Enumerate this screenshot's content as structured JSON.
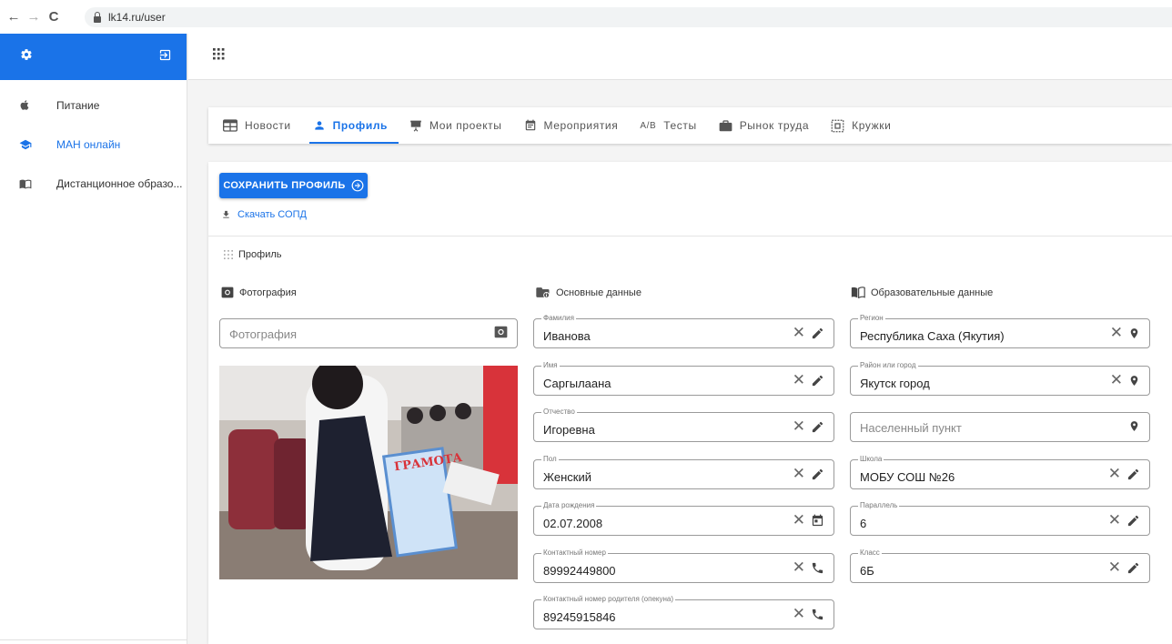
{
  "browser": {
    "url": "lk14.ru/user",
    "back_icon": "←",
    "forward_icon": "→",
    "reload_icon": "C"
  },
  "sidebar": {
    "items": [
      {
        "label": "Питание",
        "icon": "apple-icon",
        "active": false
      },
      {
        "label": "МАН онлайн",
        "icon": "graduation-cap-icon",
        "active": true
      },
      {
        "label": "Дистанционное образо...",
        "icon": "book-open-icon",
        "active": false
      }
    ]
  },
  "tabs": [
    {
      "label": "Новости",
      "icon": "newspaper-icon"
    },
    {
      "label": "Профиль",
      "icon": "person-icon",
      "active": true
    },
    {
      "label": "Мои проекты",
      "icon": "presentation-icon"
    },
    {
      "label": "Мероприятия",
      "icon": "event-note-icon"
    },
    {
      "label": "Тесты",
      "icon": "fraction-icon",
      "icon_text": "A/B"
    },
    {
      "label": "Рынок труда",
      "icon": "briefcase-icon"
    },
    {
      "label": "Кружки",
      "icon": "crop-icon"
    }
  ],
  "actions": {
    "save_label": "СОХРАНИТЬ ПРОФИЛЬ",
    "download_label": "Скачать СОПД"
  },
  "profile_section": "Профиль",
  "photo": {
    "title": "Фотография",
    "placeholder": "Фотография"
  },
  "basic": {
    "title": "Основные данные",
    "fields": [
      {
        "label": "Фамилия",
        "value": "Иванова"
      },
      {
        "label": "Имя",
        "value": "Саргылаана"
      },
      {
        "label": "Отчество",
        "value": "Игоревна"
      },
      {
        "label": "Пол",
        "value": "Женский"
      },
      {
        "label": "Дата рождения",
        "value": "02.07.2008"
      },
      {
        "label": "Контактный номер",
        "value": "89992449800"
      },
      {
        "label": "Контактный номер родителя (опекуна)",
        "value": "89245915846"
      }
    ]
  },
  "edu": {
    "title": "Образовательные данные",
    "fields": [
      {
        "label": "Регион",
        "value": "Республика Саха (Якутия)"
      },
      {
        "label": "Район или город",
        "value": "Якутск город"
      },
      {
        "label": "",
        "value": "",
        "placeholder": "Населенный пункт"
      },
      {
        "label": "Школа",
        "value": "МОБУ СОШ №26"
      },
      {
        "label": "Параллель",
        "value": "6"
      },
      {
        "label": "Класс",
        "value": "6Б"
      }
    ]
  },
  "certificate_text": "ГРАМОТА",
  "colors": {
    "accent": "#1a73e8",
    "icon_gray": "#555555"
  }
}
